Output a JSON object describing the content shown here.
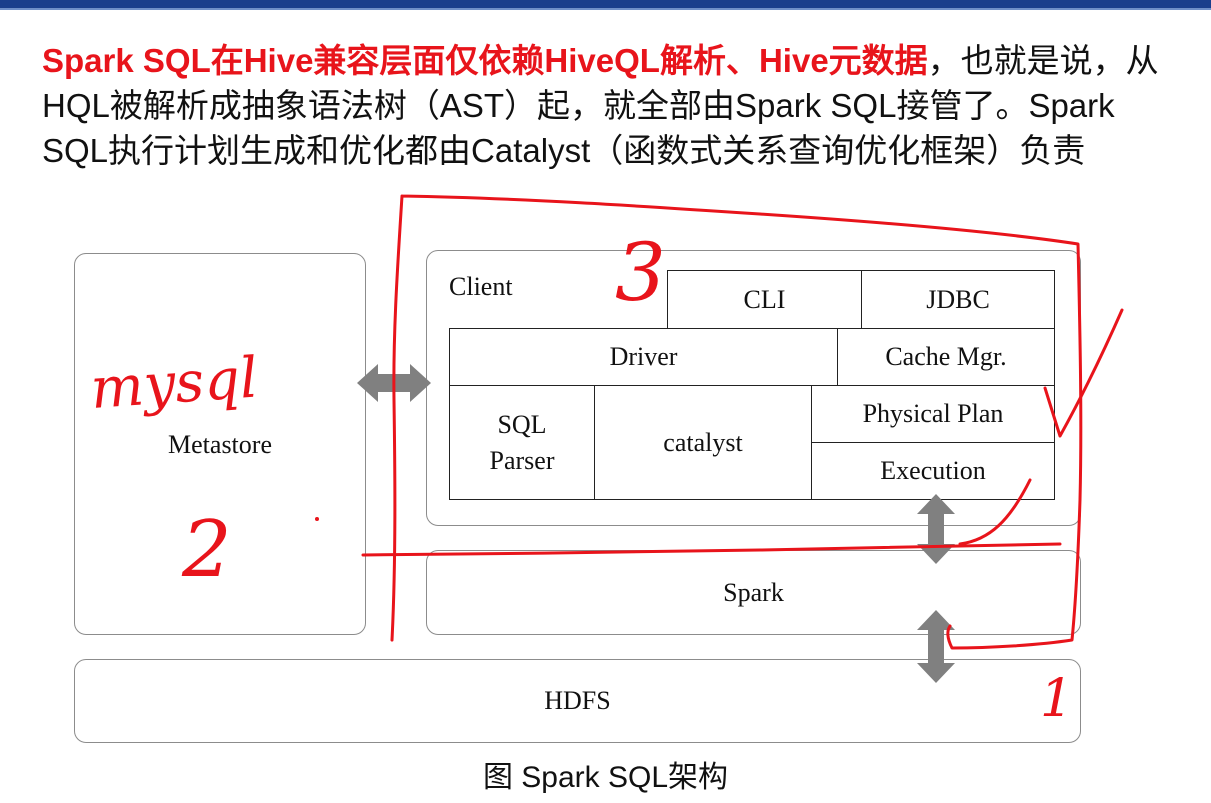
{
  "intro": {
    "red_text": "Spark SQL在Hive兼容层面仅依赖HiveQL解析、Hive元数据",
    "black_text": "，也就是说，从HQL被解析成抽象语法树（AST）起，就全部由Spark SQL接管了。Spark SQL执行计划生成和优化都由Catalyst（函数式关系查询优化框架）负责"
  },
  "diagram": {
    "metastore": "Metastore",
    "client": "Client",
    "cli": "CLI",
    "jdbc": "JDBC",
    "driver": "Driver",
    "cache_mgr": "Cache Mgr.",
    "sql_parser_line1": "SQL",
    "sql_parser_line2": "Parser",
    "catalyst": "catalyst",
    "physical_plan": "Physical Plan",
    "execution": "Execution",
    "spark": "Spark",
    "hdfs": "HDFS"
  },
  "annotations": {
    "mysql": "mysql",
    "num1": "1",
    "num2": "2",
    "num3": "3"
  },
  "caption": "图 Spark SQL架构",
  "colors": {
    "accent_red": "#e8141b",
    "arrow_gray": "#808080",
    "topbar": "#1a3e8c"
  }
}
